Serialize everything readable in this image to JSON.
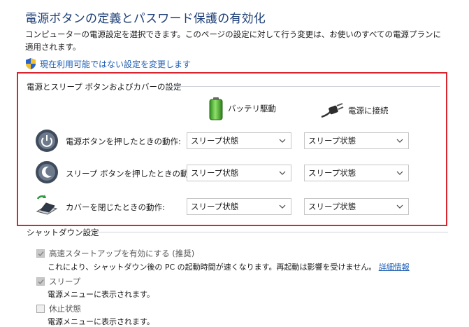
{
  "header": {
    "title": "電源ボタンの定義とパスワード保護の有効化",
    "description": "コンピューターの電源設定を選択できます。このページの設定に対して行う変更は、お使いのすべての電源プランに適用されます。",
    "change_link": "現在利用可能ではない設定を変更します"
  },
  "power_section": {
    "header": "電源とスリープ ボタンおよびカバーの設定",
    "columns": {
      "battery": "バッテリ駆動",
      "plugged": "電源に接続"
    },
    "rows": [
      {
        "label": "電源ボタンを押したときの動作:",
        "icon": "power-button-icon",
        "battery": "スリープ状態",
        "plugged": "スリープ状態"
      },
      {
        "label": "スリープ ボタンを押したときの動作:",
        "icon": "sleep-button-icon",
        "battery": "スリープ状態",
        "plugged": "スリープ状態"
      },
      {
        "label": "カバーを閉じたときの動作:",
        "icon": "laptop-lid-icon",
        "battery": "スリープ状態",
        "plugged": "スリープ状態"
      }
    ]
  },
  "shutdown": {
    "header": "シャットダウン設定",
    "items": [
      {
        "label": "高速スタートアップを有効にする (推奨)",
        "checked": true,
        "description": "これにより、シャットダウン後の PC の起動時間が速くなります。再起動は影響を受けません。",
        "link": "詳細情報"
      },
      {
        "label": "スリープ",
        "checked": true,
        "description": "電源メニューに表示されます。"
      },
      {
        "label": "休止状態",
        "checked": false,
        "description": "電源メニューに表示されます。"
      }
    ]
  },
  "colors": {
    "title": "#1e3f77",
    "link": "#1f5fb5",
    "highlight_box": "#d9252e"
  }
}
